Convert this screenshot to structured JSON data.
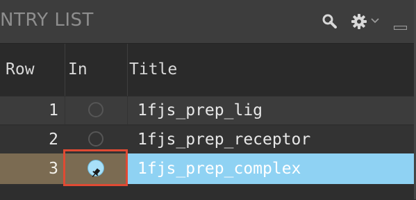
{
  "panel": {
    "title": "NTRY LIST",
    "icons": [
      "search-icon",
      "gear-icon",
      "chevron-down-icon",
      "minimize-icon"
    ]
  },
  "table": {
    "columns": [
      "Row",
      "In",
      "Title"
    ],
    "rows": [
      {
        "row": "1",
        "in": false,
        "title": "1fjs_prep_lig"
      },
      {
        "row": "2",
        "in": false,
        "title": "1fjs_prep_receptor"
      },
      {
        "row": "3",
        "in": true,
        "title": "1fjs_prep_complex"
      }
    ]
  },
  "colors": {
    "header_bg": "#3d3d3d",
    "selected_title_bg": "#8fd2f3",
    "selected_row_bg": "#7b6b52",
    "highlight_box": "#e04a33"
  }
}
